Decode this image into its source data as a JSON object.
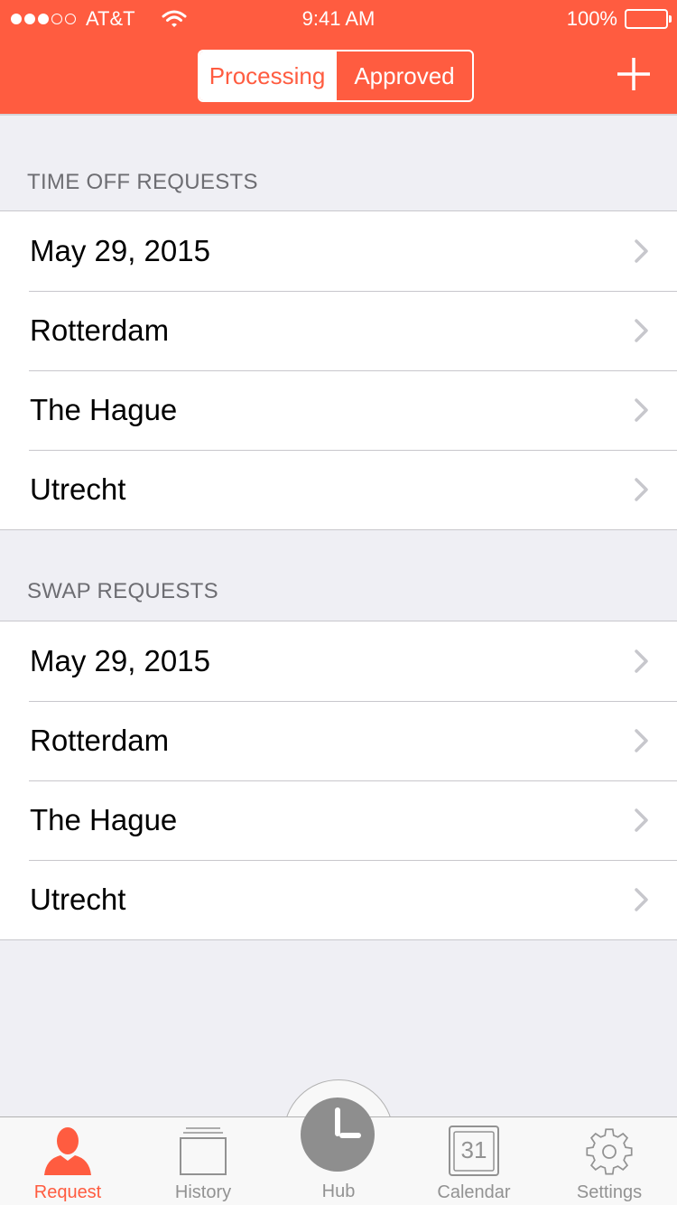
{
  "status_bar": {
    "carrier": "AT&T",
    "time": "9:41 AM",
    "battery": "100%"
  },
  "header": {
    "segments": [
      "Processing",
      "Approved"
    ],
    "active_segment": "Processing",
    "accent_color": "#ff5c40"
  },
  "sections": [
    {
      "title": "TIME OFF REQUESTS",
      "items": [
        "May 29, 2015",
        "Rotterdam",
        "The Hague",
        "Utrecht"
      ]
    },
    {
      "title": "SWAP REQUESTS",
      "items": [
        "May 29, 2015",
        "Rotterdam",
        "The Hague",
        "Utrecht"
      ]
    }
  ],
  "tabbar": {
    "tabs": [
      {
        "label": "Request",
        "icon": "person-icon"
      },
      {
        "label": "History",
        "icon": "stack-icon"
      },
      {
        "label": "Hub",
        "icon": "clock-icon"
      },
      {
        "label": "Calendar",
        "icon": "calendar-icon"
      },
      {
        "label": "Settings",
        "icon": "gear-icon"
      }
    ],
    "active_tab": "Request",
    "calendar_day": "31"
  }
}
